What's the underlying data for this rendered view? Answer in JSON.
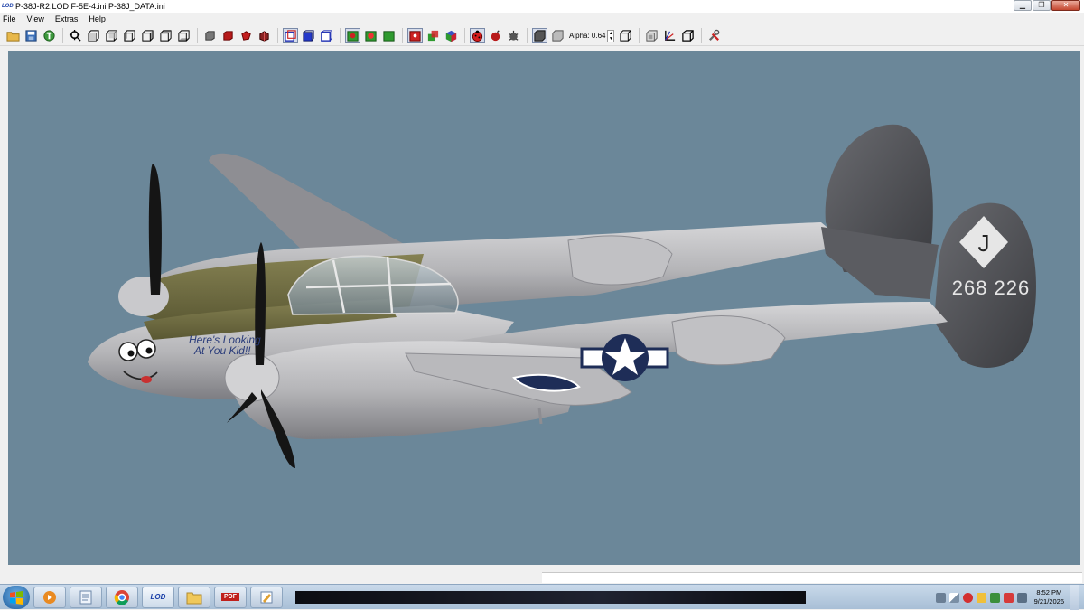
{
  "window": {
    "app_logo": "LOD",
    "title": "P-38J-R2.LOD  F-5E-4.ini  P-38J_DATA.ini",
    "minimize_icon": "minimize-icon",
    "maximize_icon": "restore-icon",
    "close_icon": "close-icon"
  },
  "menu": [
    "File",
    "View",
    "Extras",
    "Help"
  ],
  "toolbar": {
    "alpha_label": "Alpha: 0.64",
    "alpha_value": 0.64,
    "groups": [
      [
        "open-folder-icon",
        "save-icon",
        "texture-icon"
      ],
      [
        "zoom-fit-icon",
        "view-front-icon",
        "view-back-icon",
        "view-left-icon",
        "view-right-icon",
        "view-top-icon",
        "view-bottom-icon"
      ],
      [
        "shade-grey-icon",
        "shade-red-icon",
        "shade-red-left-icon",
        "shade-red-right-icon"
      ],
      [
        "box-blue-1-icon",
        "box-blue-2-icon",
        "box-blue-3-icon"
      ],
      [
        "box-green-1-icon",
        "box-green-2-icon",
        "box-green-3-icon"
      ],
      [
        "cube-red-icon",
        "cube-multi-icon",
        "cube-color-icon"
      ],
      [
        "ladybug-icon",
        "bomb-icon",
        "gear-bug-icon"
      ],
      [
        "solid-cube-icon",
        "alpha-cube-icon"
      ],
      [
        "wire-box-icon",
        "texture-box-icon",
        "axes-icon",
        "perspective-box-icon"
      ],
      [
        "tools-icon"
      ]
    ]
  },
  "viewport": {
    "background": "#6b8799",
    "model": {
      "nose_art": [
        "Here's Looking",
        "At You Kid!!"
      ],
      "tail_letter": "J",
      "serial_number": "268 226",
      "colors": {
        "body": "#b3b3b6",
        "tail": "#4e4f53",
        "nose_panel": "#6f6c3f",
        "roundel": "#1e2d57"
      }
    }
  },
  "taskbar": {
    "apps": [
      "windows-start-icon",
      "media-player-icon",
      "document-icon",
      "chrome-icon",
      "lod-icon",
      "folder-icon",
      "pdf-icon",
      "paint-icon"
    ],
    "lod_label": "LOD",
    "pdf_label": "PDF",
    "time": "8:52 PM",
    "date": "9/21/2026"
  }
}
